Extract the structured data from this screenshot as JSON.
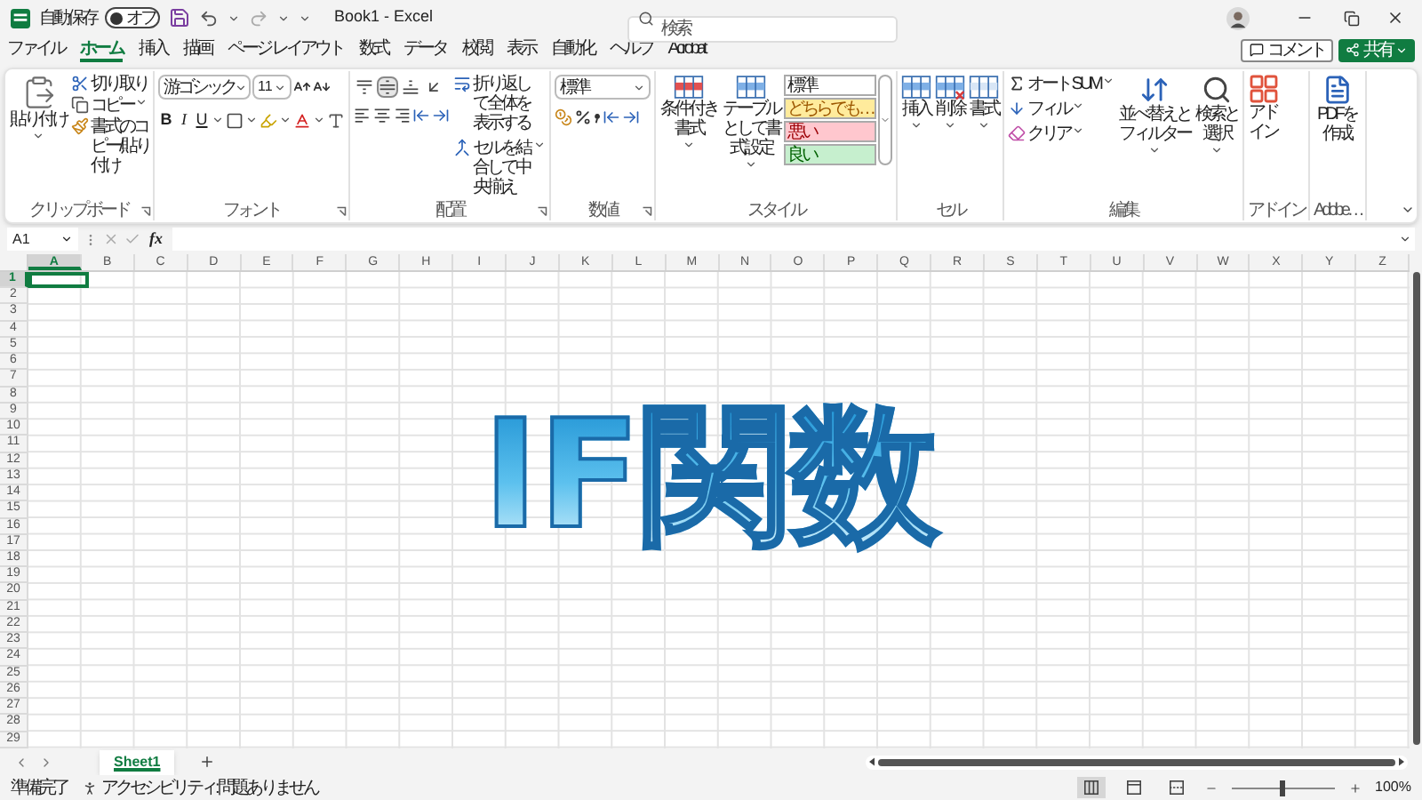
{
  "title_bar": {
    "autosave_label": "自動保存",
    "autosave_on": false,
    "autosave_state": "オフ",
    "title": "Book1 - Excel",
    "search_placeholder": "検索"
  },
  "actions": [
    {
      "kind": "outline",
      "label": "コメント"
    },
    {
      "kind": "primary",
      "label": "共有"
    }
  ],
  "menu_tabs": [
    {
      "label": "ファイル",
      "selected": false
    },
    {
      "label": "ホーム",
      "selected": true
    },
    {
      "label": "挿入",
      "selected": false
    },
    {
      "label": "描画",
      "selected": false
    },
    {
      "label": "ページ レイアウト",
      "selected": false
    },
    {
      "label": "数式",
      "selected": false
    },
    {
      "label": "データ",
      "selected": false
    },
    {
      "label": "校閲",
      "selected": false
    },
    {
      "label": "表示",
      "selected": false
    },
    {
      "label": "自動化",
      "selected": false
    },
    {
      "label": "ヘルプ",
      "selected": false
    },
    {
      "label": "Acrobat",
      "selected": false
    }
  ],
  "ribbon_groups": [
    {
      "kind": "clipboard",
      "label": "クリップボード",
      "paste": "貼り付け",
      "items": [
        "切り取り",
        "コピー",
        "書式のコピー/貼り付け"
      ]
    },
    {
      "kind": "font",
      "label": "フォント",
      "font_name": "游ゴシック",
      "font_size": "11",
      "format_buttons": [
        "B",
        "I",
        "U"
      ]
    },
    {
      "kind": "alignment",
      "label": "配置",
      "vertical_align": [
        {
          "selected": false
        },
        {
          "selected": true
        },
        {
          "selected": false
        }
      ],
      "wrap": "折り返して全体を表示する",
      "merge": "セルを結合して中央揃え"
    },
    {
      "kind": "number",
      "label": "数値",
      "format": "標準"
    },
    {
      "kind": "styles",
      "label": "スタイル",
      "conditional": "条件付き書式",
      "table": "テーブルとして書式設定",
      "cell_styles": [
        {
          "label": "標準",
          "color": "#ffffff"
        },
        {
          "label": "どちらでも…",
          "color": "#ffeb9c"
        },
        {
          "label": "悪い",
          "color": "#ffc7ce"
        },
        {
          "label": "良い",
          "color": "#c6efce"
        }
      ]
    },
    {
      "kind": "cells",
      "label": "セル",
      "items": [
        "挿入",
        "削除",
        "書式"
      ]
    },
    {
      "kind": "editing",
      "label": "編集",
      "autosum": "オート SUM",
      "fill": "フィル",
      "clear": "クリア",
      "sort": "並べ替えとフィルター",
      "find": "検索と選択"
    },
    {
      "kind": "addins",
      "label": "アドイン",
      "button": "アドイン"
    },
    {
      "kind": "adobe",
      "label": "Adobe…",
      "button": "PDFを作成"
    }
  ],
  "formula_bar": {
    "name_box": "A1",
    "fx": "fx"
  },
  "sheet": {
    "columns": [
      {
        "label": "A",
        "selected": true
      },
      {
        "label": "B",
        "selected": false
      },
      {
        "label": "C",
        "selected": false
      },
      {
        "label": "D",
        "selected": false
      },
      {
        "label": "E",
        "selected": false
      },
      {
        "label": "F",
        "selected": false
      },
      {
        "label": "G",
        "selected": false
      },
      {
        "label": "H",
        "selected": false
      },
      {
        "label": "I",
        "selected": false
      },
      {
        "label": "J",
        "selected": false
      },
      {
        "label": "K",
        "selected": false
      },
      {
        "label": "L",
        "selected": false
      },
      {
        "label": "M",
        "selected": false
      },
      {
        "label": "N",
        "selected": false
      },
      {
        "label": "O",
        "selected": false
      },
      {
        "label": "P",
        "selected": false
      },
      {
        "label": "Q",
        "selected": false
      },
      {
        "label": "R",
        "selected": false
      },
      {
        "label": "S",
        "selected": false
      },
      {
        "label": "T",
        "selected": false
      },
      {
        "label": "U",
        "selected": false
      },
      {
        "label": "V",
        "selected": false
      },
      {
        "label": "W",
        "selected": false
      },
      {
        "label": "X",
        "selected": false
      },
      {
        "label": "Y",
        "selected": false
      },
      {
        "label": "Z",
        "selected": false
      }
    ],
    "rows": [
      {
        "label": "1",
        "selected": true
      },
      {
        "label": "2",
        "selected": false
      },
      {
        "label": "3",
        "selected": false
      },
      {
        "label": "4",
        "selected": false
      },
      {
        "label": "5",
        "selected": false
      },
      {
        "label": "6",
        "selected": false
      },
      {
        "label": "7",
        "selected": false
      },
      {
        "label": "8",
        "selected": false
      },
      {
        "label": "9",
        "selected": false
      },
      {
        "label": "10",
        "selected": false
      },
      {
        "label": "11",
        "selected": false
      },
      {
        "label": "12",
        "selected": false
      },
      {
        "label": "13",
        "selected": false
      },
      {
        "label": "14",
        "selected": false
      },
      {
        "label": "15",
        "selected": false
      },
      {
        "label": "16",
        "selected": false
      },
      {
        "label": "17",
        "selected": false
      },
      {
        "label": "18",
        "selected": false
      },
      {
        "label": "19",
        "selected": false
      },
      {
        "label": "20",
        "selected": false
      },
      {
        "label": "21",
        "selected": false
      },
      {
        "label": "22",
        "selected": false
      },
      {
        "label": "23",
        "selected": false
      },
      {
        "label": "24",
        "selected": false
      },
      {
        "label": "25",
        "selected": false
      },
      {
        "label": "26",
        "selected": false
      },
      {
        "label": "27",
        "selected": false
      },
      {
        "label": "28",
        "selected": false
      },
      {
        "label": "29",
        "selected": false
      }
    ],
    "overlay_title": "IF関数"
  },
  "sheet_tabs": [
    {
      "label": "Sheet1",
      "selected": true
    }
  ],
  "status_bar": {
    "ready": "準備完了",
    "accessibility": "アクセシビリティ: 問題ありません",
    "view_modes": [
      {
        "kind": "normal",
        "selected": true
      },
      {
        "kind": "page_layout",
        "selected": false
      },
      {
        "kind": "page_break",
        "selected": false
      }
    ],
    "zoom": {
      "level": 0.5,
      "reading": "100%"
    }
  }
}
